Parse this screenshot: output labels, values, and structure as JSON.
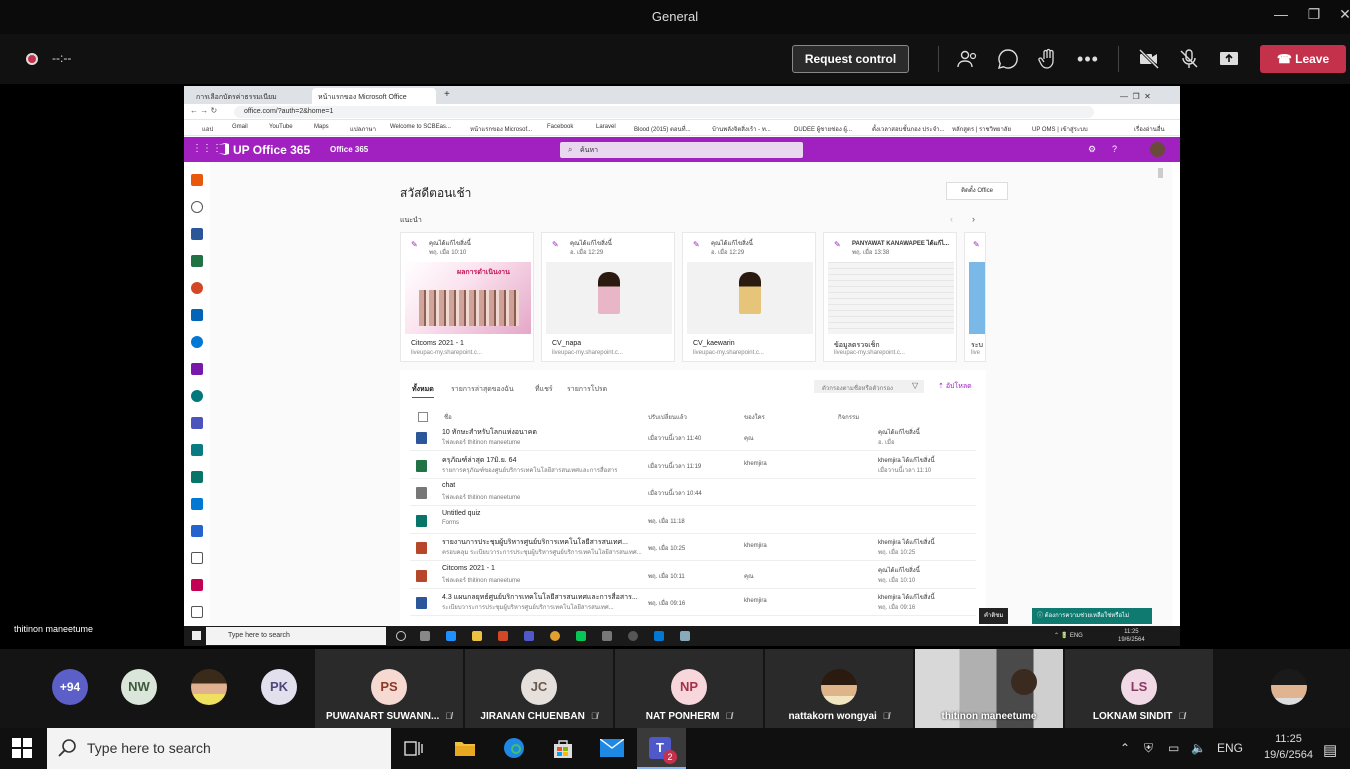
{
  "window": {
    "title": "General"
  },
  "meeting": {
    "elapsed": "--:--",
    "request_control": "Request control",
    "leave": "Leave",
    "presenter_name": "thitinon maneetume"
  },
  "browser": {
    "tabs": [
      {
        "label": "การเลือกบัตรค่าธรรมเนียม"
      },
      {
        "label": "หน้าแรกของ Microsoft Office"
      }
    ],
    "url": "office.com/?auth=2&home=1",
    "bookmarks": [
      "แอป",
      "Gmail",
      "YouTube",
      "Maps",
      "แปลภาษา",
      "Welcome to SCBEas...",
      "หน้าแรกของ Microsof...",
      "Facebook",
      "Laravel",
      "Blood (2015) ตอนที่...",
      "บ้านพลังจิตสิ่งเร้า - ท...",
      "DUDEE ผู้ชายช่อง ผู้...",
      "ตั้งเวลาสอบชั้นกอง ประจำ...",
      "หลักสูตร | ราชวิทยาลัย",
      "UP OMS | เข้าสู่ระบบ",
      "เรื่องอ่านอื่น"
    ]
  },
  "office": {
    "brand": "UP Office 365",
    "sub": "Office 365",
    "search_placeholder": "ค้นหา",
    "greeting": "สวัสดีตอนเช้า",
    "install": "ติดตั้ง Office",
    "recommended": "แนะนำ",
    "cards": [
      {
        "who": "คุณได้แก้ไขสิ่งนี้",
        "when": "พฤ. เมื่อ 10:10",
        "name": "Citcoms 2021 - 1",
        "loc": "liveupac-my.sharepoint.c...",
        "thumb_title": "ผลการดำเนินงาน"
      },
      {
        "who": "คุณได้แก้ไขสิ่งนี้",
        "when": "อ. เมื่อ 12:29",
        "name": "CV_napa",
        "loc": "liveupac-my.sharepoint.c..."
      },
      {
        "who": "คุณได้แก้ไขสิ่งนี้",
        "when": "อ. เมื่อ 12:29",
        "name": "CV_kaewarin",
        "loc": "liveupac-my.sharepoint.c..."
      },
      {
        "who": "PANYAWAT KANAWAPEE ได้แก้ไ...",
        "when": "พฤ. เมื่อ 13:38",
        "name": "ข้อมูลตรวจเช็ก",
        "loc": "liveupac-my.sharepoint.c..."
      },
      {
        "who": "",
        "when": "",
        "name": "ระบ",
        "loc": "live"
      }
    ],
    "file_tabs": [
      "ทั้งหมด",
      "รายการล่าสุดของฉัน",
      "ที่แชร์",
      "รายการโปรด"
    ],
    "filter_placeholder": "ตัวกรองตามชื่อหรือตัวกรอง",
    "upload": "อัปโหลด",
    "headers": {
      "name": "ชื่อ",
      "modified": "ปรับเปลี่ยนแล้ว",
      "owner": "ของใคร",
      "activity": "กิจกรรม"
    },
    "files": [
      {
        "name": "10 ทักษะสำหรับโลกแห่งอนาคต",
        "sub": "โฟลเดอร์ thitinon maneetume",
        "date": "เมื่อวานนี้เวลา 11:40",
        "owner": "คุณ",
        "act1": "คุณได้แก้ไขสิ่งนี้",
        "act2": "อ. เมื่อ",
        "color": "#2b579a"
      },
      {
        "name": "ครุภัณฑ์ล่าสุด 17มิ.ย. 64",
        "sub": "รายการครุภัณฑ์ของศูนย์บริการเทคโนโลยีสารสนเทศและการสื่อสาร",
        "date": "เมื่อวานนี้เวลา 11:19",
        "owner": "khemjira",
        "act1": "khemjira ได้แก้ไขสิ่งนี้",
        "act2": "เมื่อวานนี้เวลา 11:10",
        "color": "#217346"
      },
      {
        "name": "chat",
        "sub": "โฟลเดอร์ thitinon maneetume",
        "date": "เมื่อวานนี้เวลา 10:44",
        "owner": "",
        "act1": "",
        "act2": "",
        "color": "#777777"
      },
      {
        "name": "Untitled quiz",
        "sub": "Forms",
        "date": "พฤ. เมื่อ 11:18",
        "owner": "",
        "act1": "",
        "act2": "",
        "color": "#077568"
      },
      {
        "name": "รายงานการประชุมผู้บริหารศูนย์บริการเทคโนโลยีสารสนเทศ...",
        "sub": "ครอบคลุม ระเบียบวาระการประชุมผู้บริหารศูนย์บริการเทคโนโลยีสารสนเทศ...",
        "date": "พฤ. เมื่อ 10:25",
        "owner": "khemjira",
        "act1": "khemjira ได้แก้ไขสิ่งนี้",
        "act2": "พฤ. เมื่อ 10:25",
        "color": "#b7472a"
      },
      {
        "name": "Citcoms 2021 - 1",
        "sub": "โฟลเดอร์ thitinon maneetume",
        "date": "พฤ. เมื่อ 10:11",
        "owner": "คุณ",
        "act1": "คุณได้แก้ไขสิ่งนี้",
        "act2": "พฤ. เมื่อ 10:10",
        "color": "#b7472a"
      },
      {
        "name": "4.3 แผนกลยุทธ์ศูนย์บริการเทคโนโลยีสารสนเทศและการสื่อสาร...",
        "sub": "ระเบียบวาระการประชุมผู้บริหารศูนย์บริการเทคโนโลยีสารสนเทศ...",
        "date": "พฤ. เมื่อ 09:16",
        "owner": "khemjira",
        "act1": "khemjira ได้แก้ไขสิ่งนี้",
        "act2": "พฤ. เมื่อ 09:16",
        "color": "#2b579a"
      }
    ],
    "feedback": "คำติชม",
    "need_help": "ต้องการความช่วยเหลือใช่หรือไม่"
  },
  "inner_taskbar": {
    "search": "Type here to search",
    "time": "11:25",
    "date": "19/6/2564"
  },
  "participants": {
    "overflow": "+94",
    "avatars": [
      {
        "initials": "NW",
        "color": "#d9e6d9",
        "text_color": "#3d5a3d"
      },
      {
        "initials": "PK",
        "color": "#e3e0ee",
        "text_color": "#51477a"
      }
    ],
    "tiles": [
      {
        "initials": "PS",
        "name": "PUWANART SUWANN...",
        "color": "#f6d9d0",
        "text_color": "#8a3a2a"
      },
      {
        "initials": "JC",
        "name": "JIRANAN CHUENBAN",
        "color": "#e6e0dc",
        "text_color": "#6b5a4e"
      },
      {
        "initials": "NP",
        "name": "NAT PONHERM",
        "color": "#f7d6dc",
        "text_color": "#a33249"
      },
      {
        "initials": "",
        "name": "nattakorn wongyai",
        "color": "#c9b79c",
        "text_color": "#333333"
      },
      {
        "initials": "",
        "name": "thitinon maneetume",
        "color": "#888888",
        "text_color": "#ffffff"
      },
      {
        "initials": "LS",
        "name": "LOKNAM SINDIT",
        "color": "#f1d9e6",
        "text_color": "#8a3a66"
      }
    ]
  },
  "taskbar": {
    "search": "Type here to search",
    "lang": "ENG",
    "time": "11:25",
    "date": "19/6/2564",
    "teams_badge": "2"
  }
}
